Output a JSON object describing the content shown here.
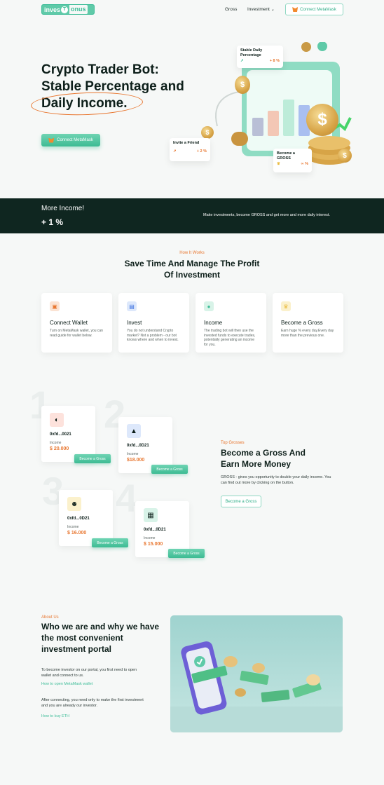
{
  "header": {
    "logo_left": "inves",
    "logo_mid": "T",
    "logo_right": "onus",
    "nav": [
      "Gross",
      "Investment"
    ],
    "connect_label": "Connect MetaMask"
  },
  "hero": {
    "title_line1": "Crypto Trader Bot:",
    "title_line2": "Stable Percentage and",
    "title_line3": "Daily Income.",
    "cta_label": "Connect MetaMask",
    "card_stable_title": "Stable Daily Percentage",
    "card_stable_value": "+ 8 %",
    "card_invite_title": "Invite a Friend",
    "card_invite_value": "+ 2 %",
    "card_gross_title": "Become a GROSS",
    "card_gross_value": "∞ %",
    "coin_symbol": "$"
  },
  "band": {
    "title": "More Income!",
    "value": "+ 1 %",
    "text": "Make investments, become GROSS and get more and more daily interest."
  },
  "how": {
    "eyebrow": "How It Works",
    "title_line1": "Save Time And Manage The Profit",
    "title_line2": "Of Investment",
    "steps": [
      {
        "title": "Connect Wallet",
        "desc": "Turn on MetaMask wallet, you can read guide for wallet below.",
        "icon": "wallet-icon",
        "color": "#fbe3d3"
      },
      {
        "title": "Invest",
        "desc": "You do not understand Crypto market? Not a problem - our bot knows where and when to invest.",
        "icon": "chart-icon",
        "color": "#dde8fb"
      },
      {
        "title": "Income",
        "desc": "The trading bot will then use the invested funds to execute trades, potentially generating an income for you.",
        "icon": "money-icon",
        "color": "#d8f3e8"
      },
      {
        "title": "Become a Gross",
        "desc": "Earn huge % every day.Every day more than the previous one.",
        "icon": "crown-icon",
        "color": "#fbf1cc"
      }
    ]
  },
  "grosses": {
    "eyebrow": "Top Grosses",
    "title_line1": "Become a Gross And",
    "title_line2": "Earn More Money",
    "desc": "GROSS - gives you opportunity to double your daily income. You can find out more by clicking on the button.",
    "cta_label": "Become a Gross",
    "numbers": [
      "1",
      "2",
      "3",
      "4"
    ],
    "cards": [
      {
        "addr": "0xfd...0021",
        "label": "Income",
        "value": "$ 20.000",
        "button": "Become a Gross",
        "icon": "watermelon-icon",
        "color": "#fde2dc"
      },
      {
        "addr": "0xfd...0D21",
        "label": "Income",
        "value": "$18.000",
        "button": "Become a Gross",
        "icon": "shark-icon",
        "color": "#dde8fb"
      },
      {
        "addr": "0xfd...0D21",
        "label": "Income",
        "value": "$ 16.000",
        "button": "Become a Gross",
        "icon": "monkey-icon",
        "color": "#fbf1cc"
      },
      {
        "addr": "0xfd...0D21",
        "label": "Income",
        "value": "$ 15.000",
        "button": "Become a Gross",
        "icon": "robot-icon",
        "color": "#d8f3e8"
      }
    ]
  },
  "about": {
    "eyebrow": "About Us",
    "title_line1": "Who we are and why we have",
    "title_line2": "the most convenient",
    "title_line3": "investment portal",
    "p1": "To become investor on our portal, you first need to open wallet and connect to us.",
    "link1": "How to open MetaMask wallet",
    "p2": "After connecting, you need only to make the first investment and you are already our investor.",
    "link2": "How to buy ETH"
  }
}
